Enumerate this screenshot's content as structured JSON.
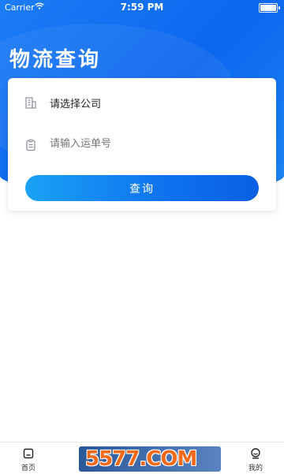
{
  "status_bar": {
    "carrier": "Carrier",
    "time": "7:59 PM"
  },
  "page_title": "物流查询",
  "form": {
    "company_label": "请选择公司",
    "tracking_placeholder": "请输入运单号",
    "tracking_value": "",
    "query_button": "查询"
  },
  "tab_bar": {
    "tabs": [
      {
        "label": "首页",
        "icon": "home-icon"
      },
      {
        "label": "",
        "icon": "tab-icon"
      },
      {
        "label": "",
        "icon": "tab-icon"
      },
      {
        "label": "我的",
        "icon": "profile-icon"
      }
    ]
  },
  "watermark": {
    "text": "5577.COM"
  },
  "colors": {
    "primary": "#0c67ef",
    "button_start": "#1aa2f6",
    "button_end": "#0a5fe3",
    "watermark_orange": "#f26a1b"
  }
}
